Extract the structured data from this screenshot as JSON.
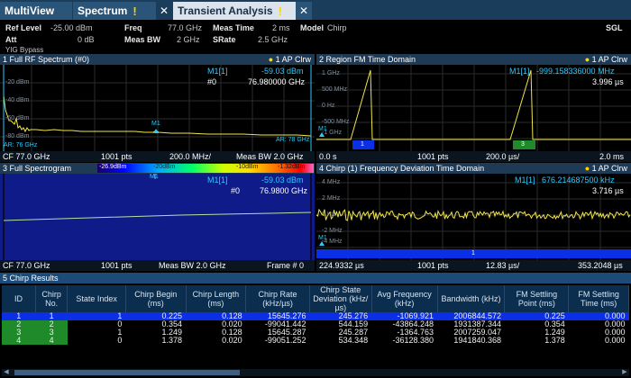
{
  "tabs": [
    {
      "label": "MultiView",
      "active": false,
      "warning": false
    },
    {
      "label": "Spectrum",
      "active": false,
      "warning": true
    },
    {
      "label": "Transient Analysis",
      "active": true,
      "warning": true
    }
  ],
  "settings": {
    "ref_level_label": "Ref Level",
    "ref_level_value": "-25.00 dBm",
    "att_label": "Att",
    "att_value": "0 dB",
    "freq_label": "Freq",
    "freq_value": "77.0 GHz",
    "meas_bw_label": "Meas BW",
    "meas_bw_value": "2 GHz",
    "meas_time_label": "Meas Time",
    "meas_time_value": "2 ms",
    "srate_label": "SRate",
    "srate_value": "2.5 GHz",
    "model_label": "Model",
    "model_value": "Chirp",
    "yig": "YIG Bypass",
    "sgl": "SGL"
  },
  "panel1": {
    "title": "1 Full RF Spectrum (#0)",
    "mode": "1 AP Clrw",
    "marker_line1": "M1[1]",
    "marker_val1": "-59.03 dBm",
    "marker_line2": "#0",
    "marker_val2": "76.980000 GHz",
    "y_labels": [
      "-20 dBm",
      "-40 dBm",
      "-60 dBm",
      "-80 dBm"
    ],
    "left_marker": "AR: 76 GHz",
    "right_marker": "AR: 78 GHz",
    "marker_tag": "M1",
    "footer": {
      "left": "CF 77.0 GHz",
      "pts": "1001 pts",
      "span": "200.0 MHz/",
      "right": "Meas BW 2.0 GHz"
    }
  },
  "panel2": {
    "title": "2 Region FM Time Domain",
    "mode": "1 AP Clrw",
    "marker_line1": "M1[1]",
    "marker_val1": "-999.158336000 MHz",
    "marker_val2": "3.996 µs",
    "y_labels": [
      "1 GHz",
      "500 MHz",
      "0 Hz",
      "-500 MHz",
      "-1 GHz"
    ],
    "marker_tag": "M1",
    "chirp_badges": [
      "1",
      "3"
    ],
    "footer": {
      "left": "0.0 s",
      "pts": "1001 pts",
      "div": "200.0 µs/",
      "right": "2.0 ms"
    }
  },
  "panel3": {
    "title": "3 Full Spectrogram",
    "colorbar_labels": [
      "-26.9dBm",
      "-20dBm",
      "-10dBm",
      "-1.32dBm"
    ],
    "marker_tag": "M1",
    "marker_line1": "M1[1]",
    "marker_val1": "-59.03 dBm",
    "marker_line2": "#0",
    "marker_val2": "76.9800 GHz",
    "footer": {
      "left": "CF 77.0 GHz",
      "pts": "1001 pts",
      "bw": "Meas BW 2.0 GHz",
      "right": "Frame # 0"
    }
  },
  "panel4": {
    "title": "4 Chirp (1) Frequency Deviation Time Domain",
    "mode": "1 AP Clrw",
    "marker_line1": "M1[1]",
    "marker_val1": "676.214687500 kHz",
    "marker_val2": "3.716 µs",
    "y_labels": [
      "4 MHz",
      "2 MHz",
      "0 Hz",
      "-2 MHz",
      "-4 MHz"
    ],
    "marker_tag": "M1",
    "chirp_badge": "1",
    "footer": {
      "left": "224.9332 µs",
      "pts": "1001 pts",
      "div": "12.83 µs/",
      "right": "353.2048 µs"
    }
  },
  "results": {
    "title": "5 Chirp Results",
    "headers": [
      "ID",
      "Chirp No.",
      "State Index",
      "Chirp Begin (ms)",
      "Chirp Length (ms)",
      "Chirp Rate (kHz/µs)",
      "Chirp State Deviation (kHz/µs)",
      "Avg Frequency (kHz)",
      "Bandwidth (kHz)",
      "FM Settling Point (ms)",
      "FM Settling Time (ms)"
    ],
    "rows": [
      [
        "1",
        "1",
        "1",
        "0.225",
        "0.128",
        "15645.276",
        "245.276",
        "-1069.921",
        "2006844.572",
        "0.225",
        "0.000"
      ],
      [
        "2",
        "2",
        "0",
        "0.354",
        "0.020",
        "-99041.442",
        "544.159",
        "-43864.248",
        "1931387.344",
        "0.354",
        "0.000"
      ],
      [
        "3",
        "3",
        "1",
        "1.249",
        "0.128",
        "15645.287",
        "245.287",
        "-1364.763",
        "2007259.047",
        "1.249",
        "0.000"
      ],
      [
        "4",
        "4",
        "0",
        "1.378",
        "0.020",
        "-99051.252",
        "534.348",
        "-36128.380",
        "1941840.368",
        "1.378",
        "0.000"
      ]
    ]
  },
  "colors": {
    "trace": "#f0e64a",
    "marker": "#2cc9ff",
    "selected_row": "#0a2fe6",
    "chirp_badge_green": "#1e8a2a",
    "tab_bar": "#1b3d5c"
  }
}
